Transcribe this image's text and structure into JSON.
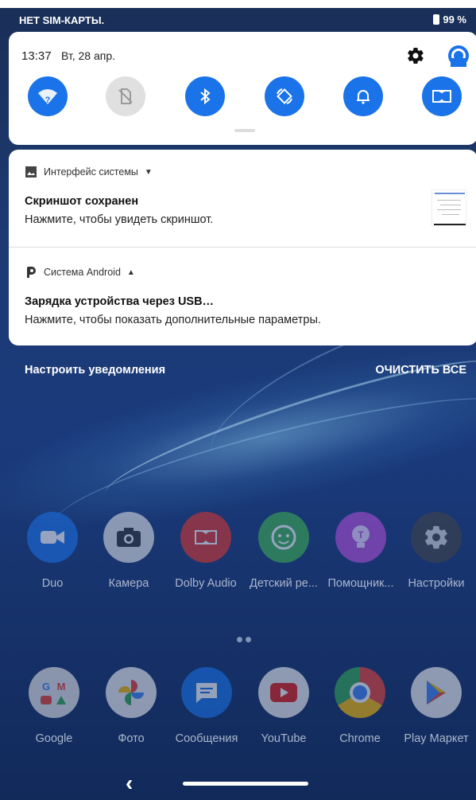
{
  "statusbar": {
    "carrier": "НЕТ SIM-КАРТЫ.",
    "battery": "99 %"
  },
  "quick_settings": {
    "time": "13:37",
    "date": "Вт, 28 апр.",
    "tiles": [
      {
        "name": "wifi-icon",
        "state": "on"
      },
      {
        "name": "no-sim-icon",
        "state": "off"
      },
      {
        "name": "bluetooth-icon",
        "state": "on"
      },
      {
        "name": "auto-rotate-icon",
        "state": "on"
      },
      {
        "name": "bell-icon",
        "state": "on"
      },
      {
        "name": "dolby-icon",
        "state": "on"
      }
    ],
    "accent": "#1a73e8"
  },
  "notifications": [
    {
      "app": "Интерфейс системы",
      "title": "Скриншот сохранен",
      "text": "Нажмите, чтобы увидеть скриншот."
    },
    {
      "app": "Система Android",
      "title": "Зарядка устройства через USB…",
      "text": "Нажмите, чтобы показать дополнительные параметры."
    }
  ],
  "actions": {
    "manage": "Настроить уведомления",
    "clear_all": "ОЧИСТИТЬ ВСЕ"
  },
  "apps_row1": [
    "Duo",
    "Камера",
    "Dolby Audio",
    "Детский ре...",
    "Помощник...",
    "Настройки"
  ],
  "apps_row2": [
    "Google",
    "Фото",
    "Сообщения",
    "YouTube",
    "Chrome",
    "Play Маркет"
  ],
  "navbar": {
    "back": "‹"
  }
}
